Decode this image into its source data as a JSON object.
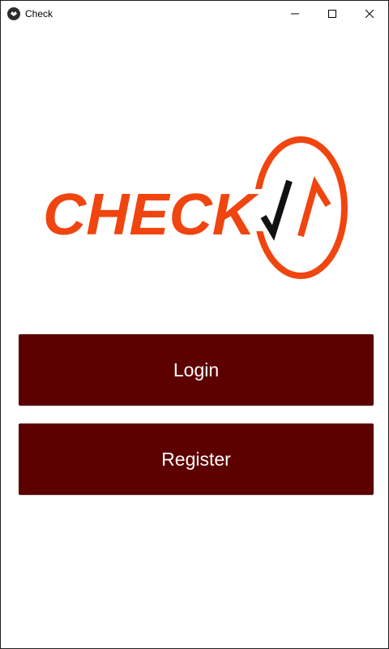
{
  "window": {
    "title": "Check",
    "controls": {
      "minimize": "minimize-icon",
      "maximize": "maximize-icon",
      "close": "close-icon"
    }
  },
  "logo": {
    "text": "CHECK",
    "colors": {
      "primary": "#f0450f",
      "check_mark": "#111111"
    }
  },
  "buttons": {
    "login_label": "Login",
    "register_label": "Register",
    "background": "#5c0000",
    "text_color": "#ffffff"
  }
}
